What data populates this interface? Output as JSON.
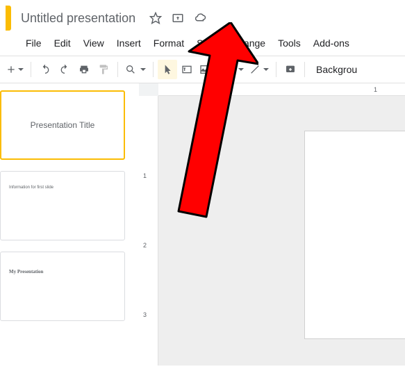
{
  "header": {
    "title": "Untitled presentation"
  },
  "menubar": {
    "items": [
      "File",
      "Edit",
      "View",
      "Insert",
      "Format",
      "Slide",
      "Arrange",
      "Tools",
      "Add-ons"
    ]
  },
  "toolbar": {
    "background_label": "Backgrou"
  },
  "slides": [
    {
      "text": "Presentation Title"
    },
    {
      "text": "Information for first slide"
    },
    {
      "text": "My Presentation"
    }
  ],
  "ruler": {
    "h_label": "1",
    "v_ticks": [
      "1",
      "2",
      "3"
    ]
  }
}
